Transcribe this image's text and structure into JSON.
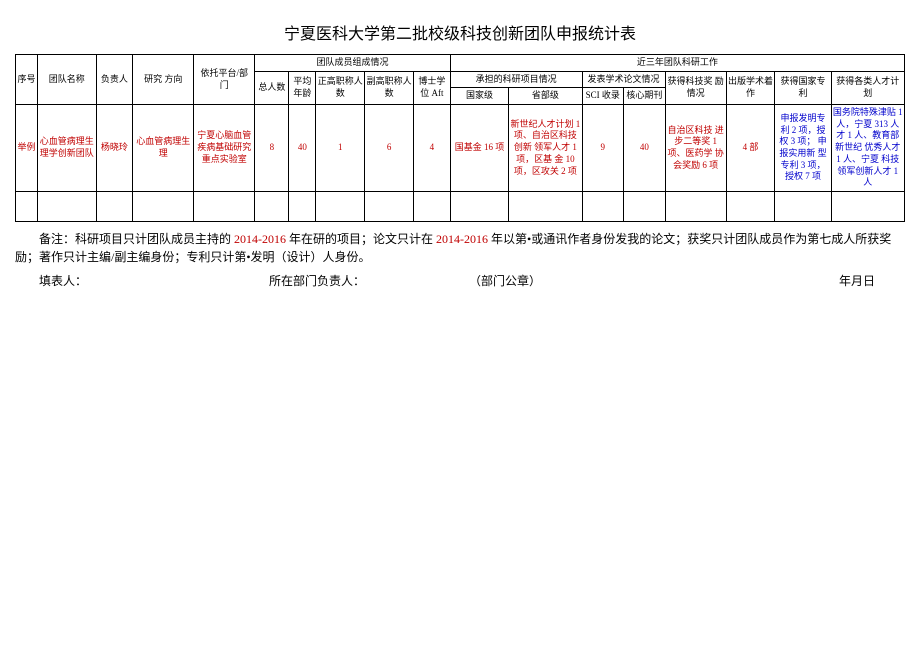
{
  "title": "宁夏医科大学第二批校级科技创新团队申报统计表",
  "headers": {
    "seq": "序号",
    "team_name": "团队名称",
    "leader": "负责人",
    "direction": "研究\n方向",
    "platform": "依托平台/部\n门",
    "member_group": "团队成员组成情况",
    "total": "总人数",
    "avg_age": "平均\n年龄",
    "senior": "正高职称人数",
    "deputy": "副高职称人\n数",
    "phd": "博士学位\nAft",
    "recent_group": "近三年团队科研工作",
    "project_group": "承担的科研项目情况",
    "national": "国家级",
    "provincial": "省部级",
    "paper_group": "发表学术论文情况",
    "sci": "SCI 收录",
    "core": "核心期刊",
    "award": "获得科技奖\n励情况",
    "book": "出版学术着\n作",
    "patent": "获得国家专\n利",
    "talent": "获得各类人才计划"
  },
  "row": {
    "seq": "举例",
    "team_name": "心血管病理生\n理学创新团队",
    "leader": "杨晓玲",
    "direction": "心血管病理生理",
    "platform": "宁夏心脑血管\n疾病基础研究\n重点实验室",
    "total": "8",
    "avg_age": "40",
    "senior": "1",
    "deputy": "6",
    "phd": "4",
    "national": "国基金 16 项",
    "provincial": "新世纪人才计划 1\n项、自治区科技创新\n领军人才 1 项，区基\n金 10 项，区攻关 2\n项",
    "sci": "9",
    "core": "40",
    "award": "自治区科技\n进步二等奖\n1 项、医药学\n协会奖励 6\n项",
    "book": "4 部",
    "patent": "申报发明专\n利 2 项，授\n权 3 项；\n申报实用新\n型专利 3 项，\n授权\n7 项",
    "talent": "国务院特殊津贴 1\n人，宁夏 313 人才 1\n人、教育部新世纪\n优秀人才 1 人、宁夏\n科技领军创新人才\n1 人"
  },
  "notes_pre": "备注：科研项目只计团队成员主持的 ",
  "notes_year1": "2014-2016",
  "notes_mid1": " 年在研的项目；论文只计在 ",
  "notes_year2": "2014-2016",
  "notes_mid2": " 年以第•或通讯作者身份发我的论文；获奖只计团队成员作为第七成人所获奖励；著作只计主编/副主编身份；专利只计第•发明（设计）人身份。",
  "footer": {
    "filler": "填表人：",
    "dept_leader": "所在部门负责人：",
    "seal": "（部门公章）",
    "date": "年月日"
  }
}
